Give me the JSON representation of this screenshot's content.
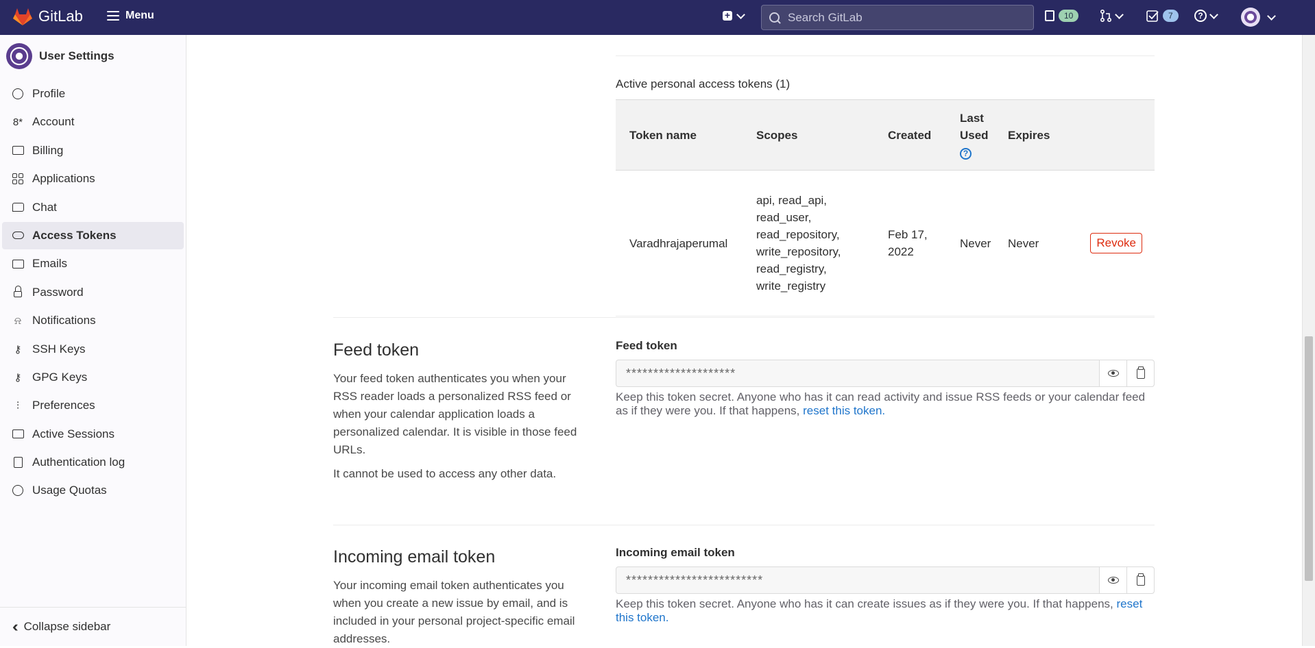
{
  "topbar": {
    "brand": "GitLab",
    "menu_label": "Menu",
    "search_placeholder": "Search GitLab",
    "issues_count": "10",
    "todos_count": "7"
  },
  "sidebar": {
    "title": "User Settings",
    "items": [
      {
        "label": "Profile",
        "icon": "profile-icon"
      },
      {
        "label": "Account",
        "icon": "account-icon"
      },
      {
        "label": "Billing",
        "icon": "billing-icon"
      },
      {
        "label": "Applications",
        "icon": "applications-icon"
      },
      {
        "label": "Chat",
        "icon": "chat-icon"
      },
      {
        "label": "Access Tokens",
        "icon": "token-icon",
        "active": true
      },
      {
        "label": "Emails",
        "icon": "mail-icon"
      },
      {
        "label": "Password",
        "icon": "lock-icon"
      },
      {
        "label": "Notifications",
        "icon": "bell-icon"
      },
      {
        "label": "SSH Keys",
        "icon": "key-icon"
      },
      {
        "label": "GPG Keys",
        "icon": "key-icon"
      },
      {
        "label": "Preferences",
        "icon": "preferences-icon"
      },
      {
        "label": "Active Sessions",
        "icon": "monitor-icon"
      },
      {
        "label": "Authentication log",
        "icon": "log-icon"
      },
      {
        "label": "Usage Quotas",
        "icon": "quota-icon"
      }
    ],
    "collapse_label": "Collapse sidebar"
  },
  "tokens": {
    "title": "Active personal access tokens (1)",
    "columns": {
      "name": "Token name",
      "scopes": "Scopes",
      "created": "Created",
      "last_used_1": "Last",
      "last_used_2": "Used",
      "expires": "Expires"
    },
    "rows": [
      {
        "name": "Varadhrajaperumal",
        "scopes": [
          "api, read_api,",
          "read_user,",
          "read_repository,",
          "write_repository,",
          "read_registry,",
          "write_registry"
        ],
        "created_1": "Feb 17,",
        "created_2": "2022",
        "last_used": "Never",
        "expires": "Never",
        "revoke_label": "Revoke"
      }
    ]
  },
  "feed": {
    "title": "Feed token",
    "desc_1": "Your feed token authenticates you when your RSS reader loads a personalized RSS feed or when your calendar application loads a personalized calendar. It is visible in those feed URLs.",
    "desc_2": "It cannot be used to access any other data.",
    "field_label": "Feed token",
    "value": "********************",
    "help": "Keep this token secret. Anyone who has it can read activity and issue RSS feeds or your calendar feed as if they were you. If that happens,",
    "help_link": "reset this token."
  },
  "incoming": {
    "title": "Incoming email token",
    "desc": "Your incoming email token authenticates you when you create a new issue by email, and is included in your personal project-specific email addresses.",
    "field_label": "Incoming email token",
    "value": "*************************",
    "help": "Keep this token secret. Anyone who has it can create issues as if they were you. If that happens,",
    "help_link": "reset this token."
  }
}
